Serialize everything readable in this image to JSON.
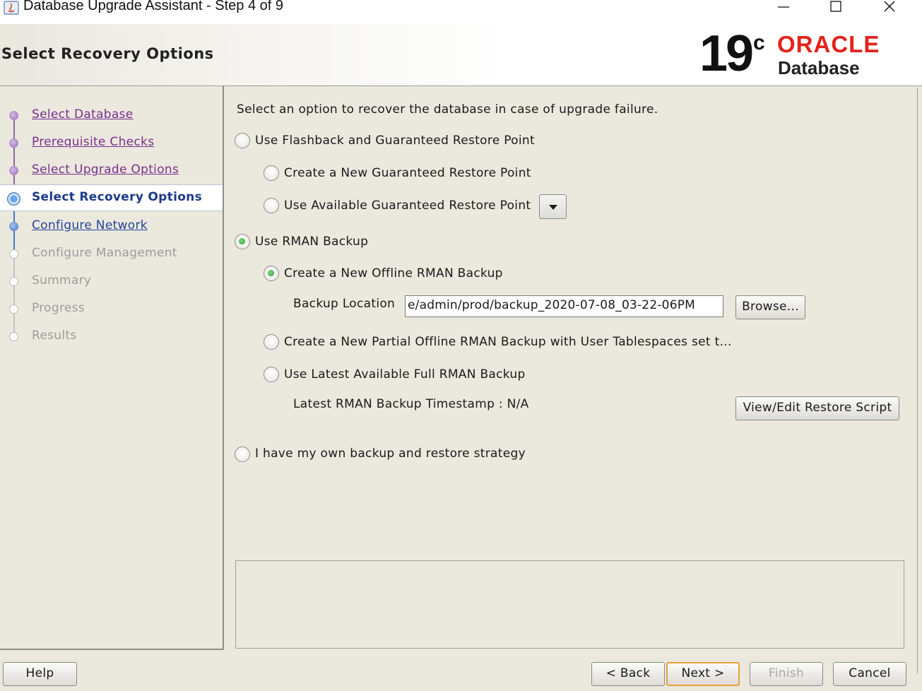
{
  "window": {
    "title": "Database Upgrade Assistant - Step 4 of 9"
  },
  "header": {
    "page_title": "Select Recovery Options",
    "logo": {
      "version": "19",
      "superscript": "c",
      "brand": "ORACLE",
      "product": "Database",
      "brand_color": "#e2231a"
    }
  },
  "nav": {
    "items": [
      {
        "label": "Select Database",
        "state": "visited"
      },
      {
        "label": "Prerequisite Checks",
        "state": "visited"
      },
      {
        "label": "Select Upgrade Options",
        "state": "visited"
      },
      {
        "label": "Select Recovery Options",
        "state": "current"
      },
      {
        "label": "Configure Network",
        "state": "link"
      },
      {
        "label": "Configure Management",
        "state": "disabled"
      },
      {
        "label": "Summary",
        "state": "disabled"
      },
      {
        "label": "Progress",
        "state": "disabled"
      },
      {
        "label": "Results",
        "state": "disabled"
      }
    ]
  },
  "main": {
    "instruction": "Select an option to recover the database in case of upgrade failure.",
    "flashback": {
      "label": "Use Flashback and Guaranteed Restore Point",
      "selected": false,
      "create_new": {
        "label": "Create a New Guaranteed Restore Point",
        "selected": false
      },
      "use_available": {
        "label": "Use Available Guaranteed Restore Point",
        "selected": false
      }
    },
    "rman": {
      "label": "Use RMAN Backup",
      "selected": true,
      "offline": {
        "label": "Create a New Offline RMAN Backup",
        "selected": true
      },
      "backup_location_label": "Backup Location",
      "backup_location_value": "e/admin/prod/backup_2020-07-08_03-22-06PM",
      "browse_label": "Browse...",
      "partial": {
        "label": "Create a New Partial Offline RMAN Backup with User Tablespaces set t...",
        "selected": false
      },
      "latest": {
        "label": "Use Latest Available Full RMAN Backup",
        "selected": false
      },
      "timestamp_text": "Latest RMAN Backup Timestamp : N/A",
      "view_edit_label": "View/Edit Restore Script"
    },
    "own_strategy": {
      "label": "I have my own backup and restore strategy",
      "selected": false
    }
  },
  "footer": {
    "help": "Help",
    "back": "< Back",
    "next": "Next >",
    "finish": "Finish",
    "cancel": "Cancel"
  }
}
